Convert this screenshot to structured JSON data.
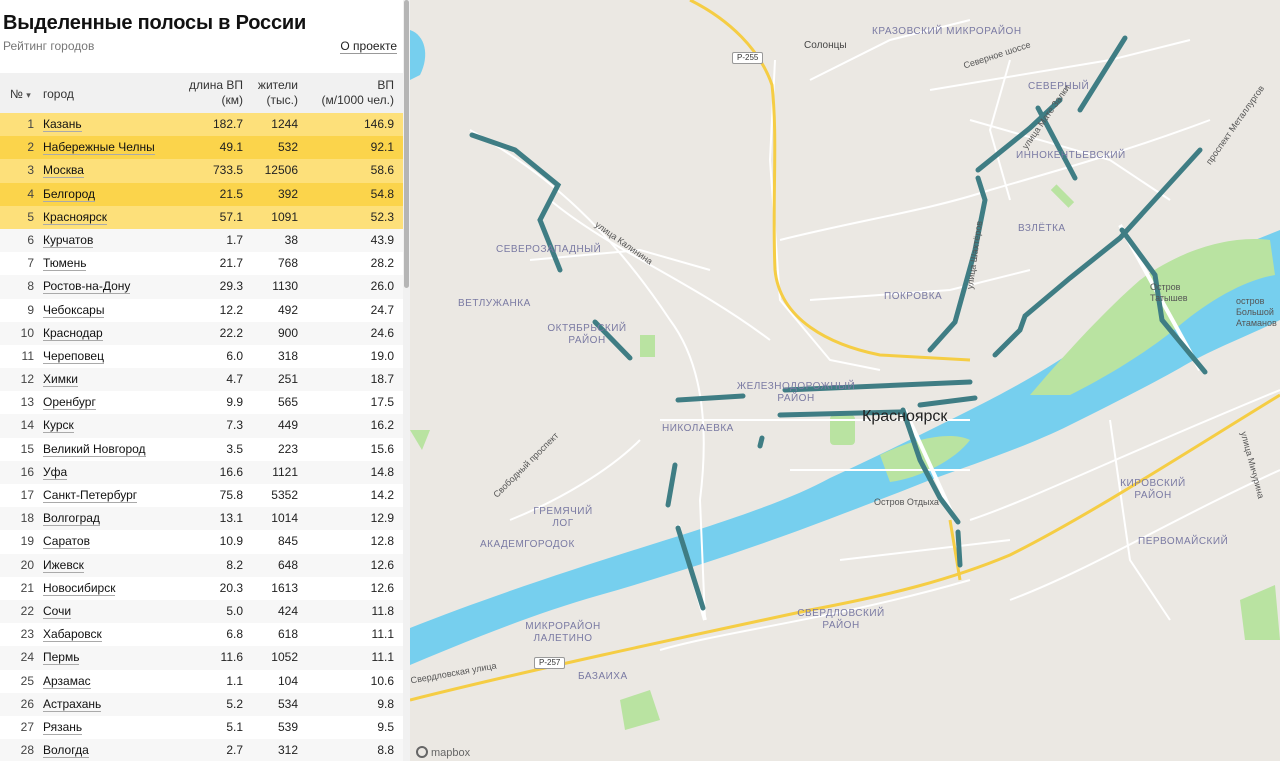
{
  "header": {
    "title": "Выделенные полосы в России",
    "subtitle": "Рейтинг городов",
    "about_link": "О проекте"
  },
  "table": {
    "sort_indicator": "▾",
    "columns": {
      "num": "№",
      "city": "город",
      "length": [
        "длина ВП",
        "(км)"
      ],
      "population": [
        "жители",
        "(тыс.)"
      ],
      "ratio": [
        "ВП",
        "(м/1000 чел.)"
      ]
    },
    "rows": [
      {
        "num": "1",
        "city": "Казань",
        "length": "182.7",
        "population": "1244",
        "ratio": "146.9"
      },
      {
        "num": "2",
        "city": "Набережные Челны",
        "length": "49.1",
        "population": "532",
        "ratio": "92.1"
      },
      {
        "num": "3",
        "city": "Москва",
        "length": "733.5",
        "population": "12506",
        "ratio": "58.6"
      },
      {
        "num": "4",
        "city": "Белгород",
        "length": "21.5",
        "population": "392",
        "ratio": "54.8"
      },
      {
        "num": "5",
        "city": "Красноярск",
        "length": "57.1",
        "population": "1091",
        "ratio": "52.3"
      },
      {
        "num": "6",
        "city": "Курчатов",
        "length": "1.7",
        "population": "38",
        "ratio": "43.9"
      },
      {
        "num": "7",
        "city": "Тюмень",
        "length": "21.7",
        "population": "768",
        "ratio": "28.2"
      },
      {
        "num": "8",
        "city": "Ростов-на-Дону",
        "length": "29.3",
        "population": "1130",
        "ratio": "26.0"
      },
      {
        "num": "9",
        "city": "Чебоксары",
        "length": "12.2",
        "population": "492",
        "ratio": "24.7"
      },
      {
        "num": "10",
        "city": "Краснодар",
        "length": "22.2",
        "population": "900",
        "ratio": "24.6"
      },
      {
        "num": "11",
        "city": "Череповец",
        "length": "6.0",
        "population": "318",
        "ratio": "19.0"
      },
      {
        "num": "12",
        "city": "Химки",
        "length": "4.7",
        "population": "251",
        "ratio": "18.7"
      },
      {
        "num": "13",
        "city": "Оренбург",
        "length": "9.9",
        "population": "565",
        "ratio": "17.5"
      },
      {
        "num": "14",
        "city": "Курск",
        "length": "7.3",
        "population": "449",
        "ratio": "16.2"
      },
      {
        "num": "15",
        "city": "Великий Новгород",
        "length": "3.5",
        "population": "223",
        "ratio": "15.6"
      },
      {
        "num": "16",
        "city": "Уфа",
        "length": "16.6",
        "population": "1121",
        "ratio": "14.8"
      },
      {
        "num": "17",
        "city": "Санкт-Петербург",
        "length": "75.8",
        "population": "5352",
        "ratio": "14.2"
      },
      {
        "num": "18",
        "city": "Волгоград",
        "length": "13.1",
        "population": "1014",
        "ratio": "12.9"
      },
      {
        "num": "19",
        "city": "Саратов",
        "length": "10.9",
        "population": "845",
        "ratio": "12.8"
      },
      {
        "num": "20",
        "city": "Ижевск",
        "length": "8.2",
        "population": "648",
        "ratio": "12.6"
      },
      {
        "num": "21",
        "city": "Новосибирск",
        "length": "20.3",
        "population": "1613",
        "ratio": "12.6"
      },
      {
        "num": "22",
        "city": "Сочи",
        "length": "5.0",
        "population": "424",
        "ratio": "11.8"
      },
      {
        "num": "23",
        "city": "Хабаровск",
        "length": "6.8",
        "population": "618",
        "ratio": "11.1"
      },
      {
        "num": "24",
        "city": "Пермь",
        "length": "11.6",
        "population": "1052",
        "ratio": "11.1"
      },
      {
        "num": "25",
        "city": "Арзамас",
        "length": "1.1",
        "population": "104",
        "ratio": "10.6"
      },
      {
        "num": "26",
        "city": "Астрахань",
        "length": "5.2",
        "population": "534",
        "ratio": "9.8"
      },
      {
        "num": "27",
        "city": "Рязань",
        "length": "5.1",
        "population": "539",
        "ratio": "9.5"
      },
      {
        "num": "28",
        "city": "Вологда",
        "length": "2.7",
        "population": "312",
        "ratio": "8.8"
      }
    ]
  },
  "map": {
    "city": "Красноярск",
    "districts": [
      "КРАЗОВСКИЙ МИКРОРАЙОН",
      "СЕВЕРНЫЙ",
      "ИННОКЕНТЬЕВСКИЙ",
      "ВЗЛЁТКА",
      "ПОКРОВКА",
      "СЕВЕРОЗАПАДНЫЙ",
      "ВЕТЛУЖАНКА",
      "ОКТЯБРЬСКИЙ РАЙОН",
      "ЖЕЛЕЗНОДОРОЖНЫЙ РАЙОН",
      "НИКОЛАЕВКА",
      "ГРЕМЯЧИЙ ЛОГ",
      "АКАДЕМГОРОДОК",
      "КИРОВСКИЙ РАЙОН",
      "ПЕРВОМАЙСКИЙ",
      "МИКРОРАЙОН ЛАЛЕТИНО",
      "СВЕРДЛОВСКИЙ РАЙОН",
      "БАЗАИХА"
    ],
    "places": [
      "Солонцы",
      "Остров Отдыха",
      "Остров Татышев",
      "остров Большой Атаманов"
    ],
    "streets": [
      "Северное шоссе",
      "улица Мате Залки",
      "проспект Металлургов",
      "улица Шахтёров",
      "улица Калинина",
      "Свободный проспект",
      "Свердловская улица",
      "улица Мичурина"
    ],
    "shields": [
      "Р-255",
      "Р-257"
    ],
    "attribution": "mapbox",
    "colors": {
      "land": "#ebe8e3",
      "water": "#76cfee",
      "park": "#b9e3a1",
      "bus_lane": "#3f7d84",
      "highway": "#f5cd44"
    }
  }
}
